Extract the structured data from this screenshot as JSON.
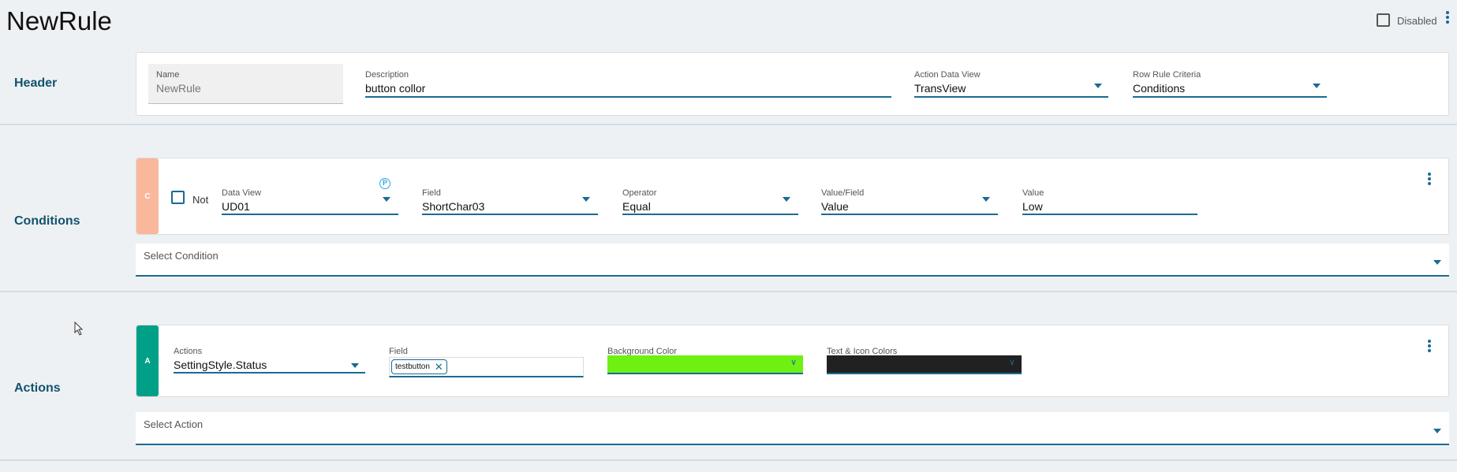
{
  "page": {
    "title": "NewRule",
    "disabled_label": "Disabled",
    "disabled_checked": false
  },
  "header": {
    "section_label": "Header",
    "name": {
      "label": "Name",
      "value": "NewRule"
    },
    "description": {
      "label": "Description",
      "value": "button collor"
    },
    "action_data_view": {
      "label": "Action Data View",
      "value": "TransView"
    },
    "row_rule_criteria": {
      "label": "Row Rule Criteria",
      "value": "Conditions"
    }
  },
  "conditions": {
    "section_label": "Conditions",
    "strip_letter": "C",
    "strip_color": "#f9b79b",
    "not_label": "Not",
    "not_checked": false,
    "data_view": {
      "label": "Data View",
      "value": "UD01",
      "badge": "P"
    },
    "field": {
      "label": "Field",
      "value": "ShortChar03"
    },
    "operator": {
      "label": "Operator",
      "value": "Equal"
    },
    "value_field": {
      "label": "Value/Field",
      "value": "Value"
    },
    "value": {
      "label": "Value",
      "value": "Low"
    },
    "select_placeholder": "Select Condition"
  },
  "actions": {
    "section_label": "Actions",
    "strip_letter": "A",
    "strip_color": "#00a088",
    "action": {
      "label": "Actions",
      "value": "SettingStyle.Status"
    },
    "field": {
      "label": "Field",
      "chips": [
        "testbutton"
      ]
    },
    "background_color": {
      "label": "Background Color",
      "color": "#6ff013"
    },
    "text_icon_colors": {
      "label": "Text & Icon Colors",
      "color": "#212121"
    },
    "select_placeholder": "Select Action"
  }
}
